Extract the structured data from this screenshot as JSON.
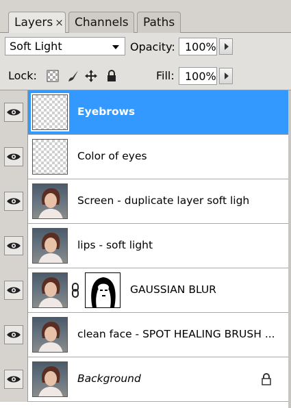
{
  "tabs": [
    {
      "label": "Layers",
      "close": "×"
    },
    {
      "label": "Channels"
    },
    {
      "label": "Paths"
    }
  ],
  "blend": {
    "mode": "Soft Light",
    "opacity_label": "Opacity:",
    "opacity_value": "100%"
  },
  "lock": {
    "label": "Lock:",
    "fill_label": "Fill:",
    "fill_value": "100%"
  },
  "layers": [
    {
      "name": "Eyebrows",
      "selected": true
    },
    {
      "name": "Color of eyes"
    },
    {
      "name": "Screen - duplicate layer soft ligh"
    },
    {
      "name": "lips - soft light"
    },
    {
      "name": "GAUSSIAN BLUR",
      "has_mask": true
    },
    {
      "name": "clean face - SPOT HEALING BRUSH ..."
    },
    {
      "name": "Background",
      "locked": true
    }
  ],
  "colors": {
    "selection": "#3399ff",
    "panel": "#d6d3ce"
  },
  "icons": [
    "eye-icon",
    "lock-transparent-icon",
    "brush-icon",
    "move-icon",
    "lock-all-icon",
    "chain-link-icon",
    "layer-lock-icon"
  ]
}
